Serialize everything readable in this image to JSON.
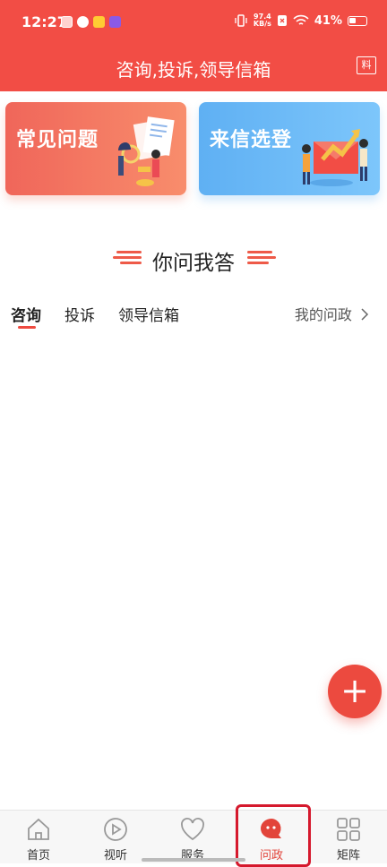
{
  "status_bar": {
    "time": "12:27",
    "net_speed_value": "97.4",
    "net_speed_unit": "KB/s",
    "battery": "41%"
  },
  "header": {
    "title": "咨询,投诉,领导信箱",
    "right_icon_glyph": "料"
  },
  "cards": [
    {
      "label": "常见问题",
      "color": "#f0665a"
    },
    {
      "label": "来信选登",
      "color": "#5fb0f3"
    }
  ],
  "section": {
    "title": "你问我答"
  },
  "tabs": {
    "items": [
      "咨询",
      "投诉",
      "领导信箱"
    ],
    "active": "咨询",
    "right_link": "我的问政"
  },
  "fab": {
    "glyph": "+"
  },
  "bottom_nav": {
    "items": [
      {
        "label": "首页",
        "icon": "home-icon"
      },
      {
        "label": "视听",
        "icon": "play-icon"
      },
      {
        "label": "服务",
        "icon": "heart-icon"
      },
      {
        "label": "问政",
        "icon": "chat-bubble-icon"
      },
      {
        "label": "矩阵",
        "icon": "grid-icon"
      }
    ],
    "active": "问政"
  },
  "colors": {
    "accent": "#f24d45",
    "active_tab": "#e2443a"
  }
}
